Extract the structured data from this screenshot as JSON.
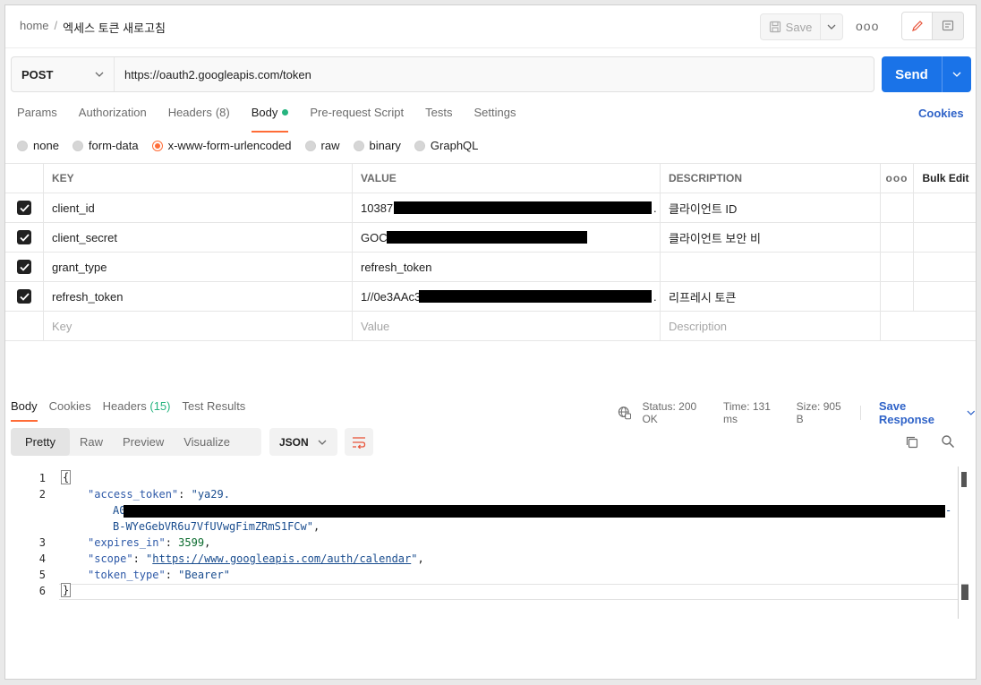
{
  "breadcrumb": {
    "root": "home",
    "separator": "/",
    "current": "엑세스 토큰 새로고침"
  },
  "header": {
    "save_label": "Save",
    "more_label": "ooo"
  },
  "request": {
    "method": "POST",
    "url": "https://oauth2.googleapis.com/token",
    "send_label": "Send"
  },
  "request_tabs": {
    "params": "Params",
    "authorization": "Authorization",
    "headers": "Headers",
    "headers_count": "(8)",
    "body": "Body",
    "pre_request": "Pre-request Script",
    "tests": "Tests",
    "settings": "Settings",
    "cookies": "Cookies"
  },
  "body_types": {
    "none": "none",
    "form_data": "form-data",
    "urlencoded": "x-www-form-urlencoded",
    "raw": "raw",
    "binary": "binary",
    "graphql": "GraphQL"
  },
  "params_table": {
    "headers": {
      "key": "KEY",
      "value": "VALUE",
      "description": "DESCRIPTION",
      "more": "ooo",
      "bulk_edit": "Bulk Edit"
    },
    "rows": [
      {
        "key": "client_id",
        "value": "10387",
        "value_tail": ".",
        "description": "클라이언트 ID"
      },
      {
        "key": "client_secret",
        "value": "GOC",
        "value_tail": "",
        "description": "클라이언트 보안 비"
      },
      {
        "key": "grant_type",
        "value": "refresh_token",
        "value_tail": "",
        "description": ""
      },
      {
        "key": "refresh_token",
        "value": "1//0e3AAc3",
        "value_tail": ".",
        "description": "리프레시 토큰"
      }
    ],
    "placeholders": {
      "key": "Key",
      "value": "Value",
      "description": "Description"
    }
  },
  "response_tabs": {
    "body": "Body",
    "cookies": "Cookies",
    "headers": "Headers",
    "headers_count": "(15)",
    "test_results": "Test Results"
  },
  "response_meta": {
    "status_label": "Status:",
    "status_value": "200 OK",
    "time_label": "Time:",
    "time_value": "131 ms",
    "size_label": "Size:",
    "size_value": "905 B",
    "save_response": "Save Response"
  },
  "view_modes": {
    "pretty": "Pretty",
    "raw": "Raw",
    "preview": "Preview",
    "visualize": "Visualize"
  },
  "format": "JSON",
  "code": {
    "line_numbers": [
      "1",
      "2",
      "3",
      "4",
      "5",
      "6"
    ],
    "open_brace": "{",
    "close_brace": "}",
    "access_token_key": "\"access_token\"",
    "access_token_start": "\"ya29.",
    "access_token_mid": "A0",
    "access_token_dash": "-",
    "access_token_end": "B-WYeGebVR6u7VfUVwgFimZRmS1FCw\"",
    "expires_in_key": "\"expires_in\"",
    "expires_in_value": "3599",
    "scope_key": "\"scope\"",
    "scope_value": "https://www.googleapis.com/auth/calendar",
    "token_type_key": "\"token_type\"",
    "token_type_value": "\"Bearer\""
  }
}
